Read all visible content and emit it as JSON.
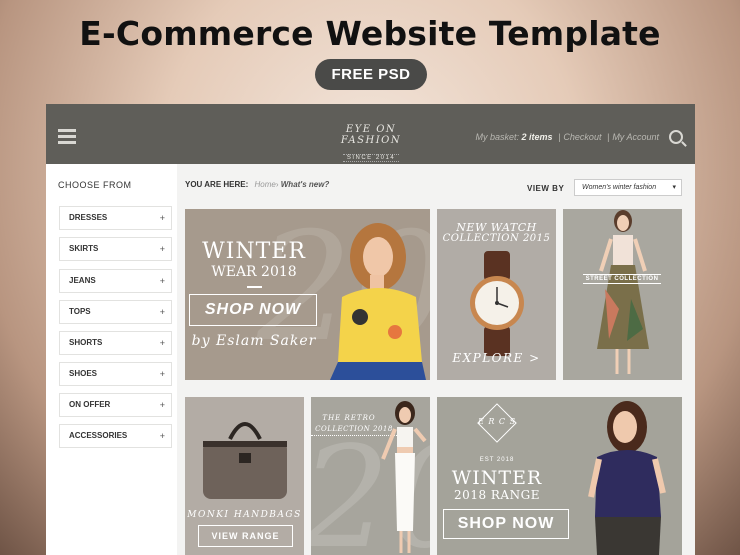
{
  "headline": "E-Commerce Website Template",
  "badge": "FREE PSD",
  "header": {
    "logo_line1": "EYE ON FASHION",
    "logo_line2": "SINCE 2014",
    "basket_label": "My basket:",
    "basket_count": "2 items",
    "checkout": "Checkout",
    "account": "My Account"
  },
  "sidebar": {
    "title": "CHOOSE FROM",
    "items": [
      {
        "label": "DRESSES"
      },
      {
        "label": "SKIRTS"
      },
      {
        "label": "JEANS"
      },
      {
        "label": "TOPS"
      },
      {
        "label": "SHORTS"
      },
      {
        "label": "SHOES"
      },
      {
        "label": "ON OFFER"
      },
      {
        "label": "ACCESSORIES"
      }
    ],
    "plus": "+"
  },
  "breadcrumb": {
    "label": "YOU ARE HERE:",
    "home": "Home",
    "separator": "›",
    "current": "What's new?"
  },
  "view_by": {
    "label": "VIEW BY",
    "selected": "Women's winter fashion"
  },
  "tiles": {
    "winter": {
      "title": "WINTER",
      "subtitle": "WEAR 2018",
      "button": "SHOP NOW",
      "byline": "by Eslam Saker",
      "bg_digits": "20"
    },
    "watch": {
      "title_line1": "NEW WATCH",
      "title_line2": "COLLECTION 2015",
      "link": "EXPLORE >"
    },
    "street": {
      "label": "STREET COLLECTION"
    },
    "handbags": {
      "title": "MONKI HANDBAGS",
      "button": "VIEW RANGE"
    },
    "retro": {
      "line1": "THE RETRO",
      "line2": "COLLECTION 2018",
      "bg_digits": "20"
    },
    "winter_range": {
      "monogram": "E R C S",
      "est": "EST 2018",
      "title": "WINTER",
      "subtitle": "2018 RANGE",
      "button": "SHOP NOW"
    }
  },
  "colors": {
    "topbar": "#5f5e59",
    "tile_taupe": "#a69a8d",
    "tile_grey": "#b1aca6",
    "tile_sage": "#a4a39a"
  }
}
